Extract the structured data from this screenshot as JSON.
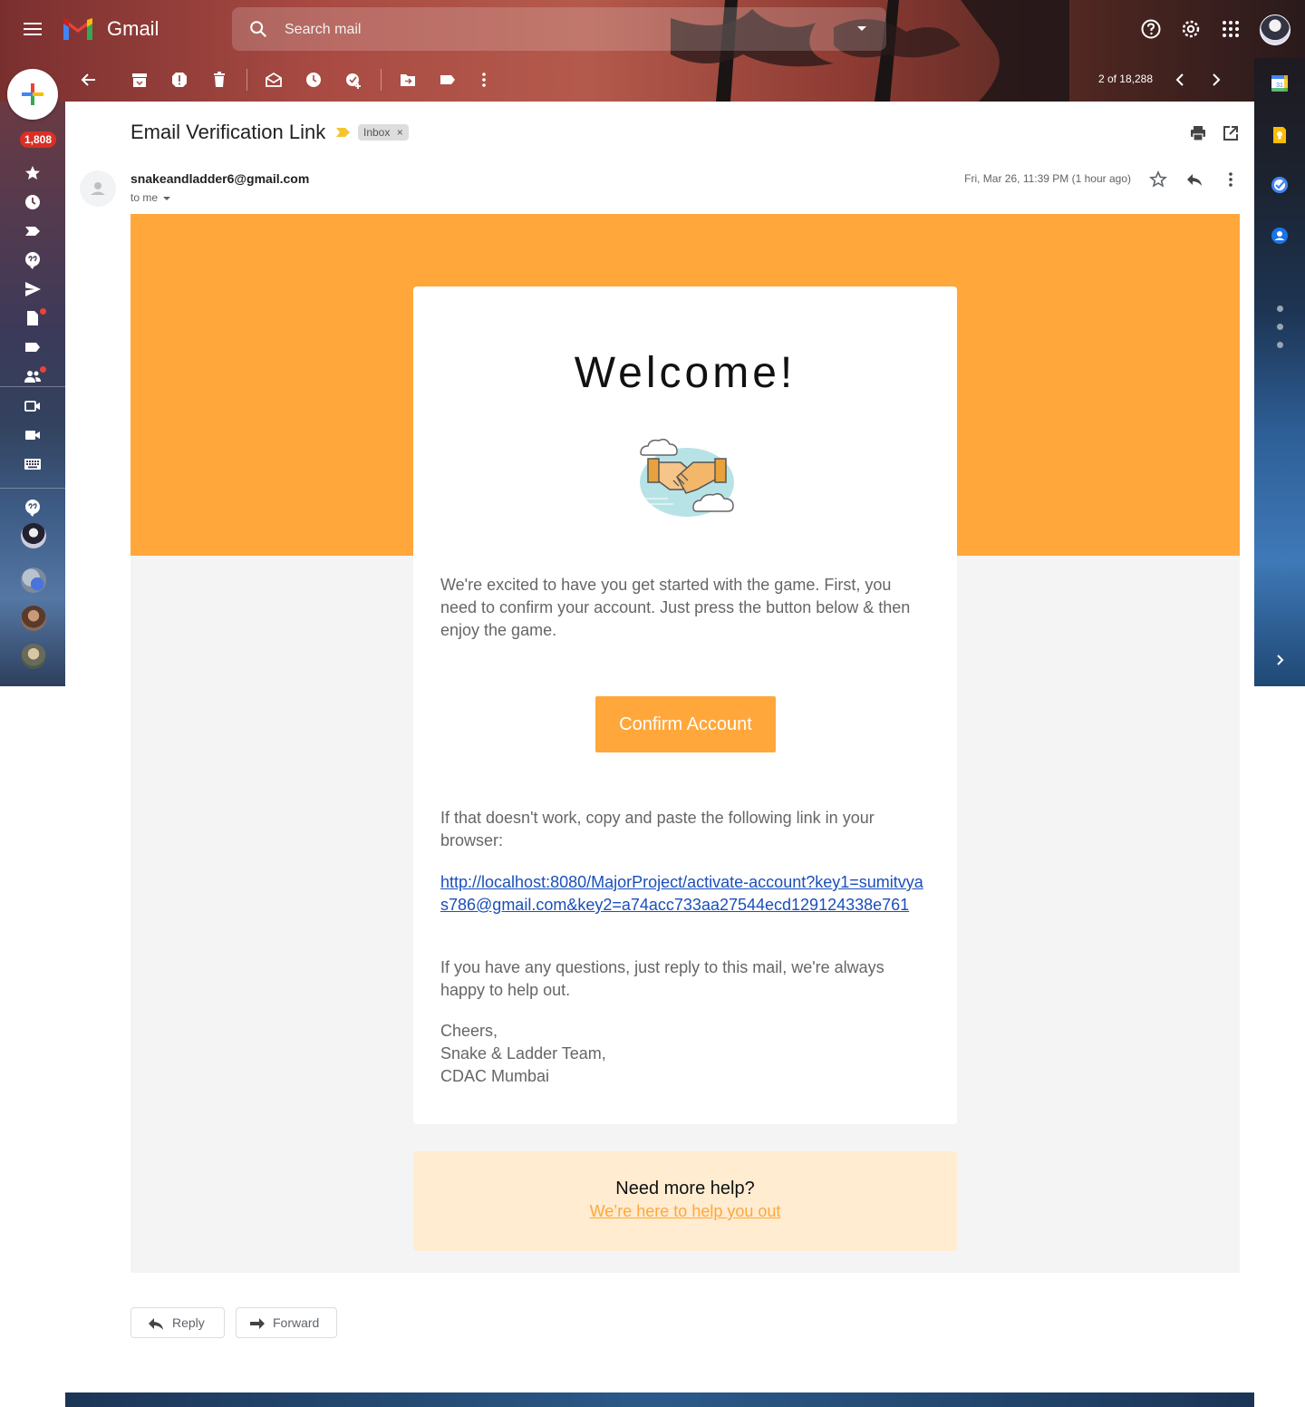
{
  "app": {
    "name": "Gmail"
  },
  "search": {
    "placeholder": "Search mail"
  },
  "toolbar": {
    "pager": "2 of 18,288"
  },
  "nav": {
    "inbox_badge": "1,808"
  },
  "message": {
    "subject": "Email Verification Link",
    "label_chip": "Inbox",
    "sender": "snakeandladder6@gmail.com",
    "recipient": "to me",
    "date": "Fri, Mar 26, 11:39 PM (1 hour ago)"
  },
  "email": {
    "heading": "Welcome!",
    "intro": "We're excited to have you get started with the game. First, you need to confirm your account. Just press the button below & then enjoy the game.",
    "button_label": "Confirm Account",
    "fallback_text": "If that doesn't work, copy and paste the following link in your browser:",
    "link": "http://localhost:8080/MajorProject/activate-account?key1=sumitvyas786@gmail.com&key2=a74acc733aa27544ecd129124338e761",
    "questions_text": "If you have any questions, just reply to this mail, we're always happy to help out.",
    "signoff": [
      "Cheers,",
      "Snake & Ladder Team,",
      "CDAC Mumbai"
    ],
    "help_title": "Need more help?",
    "help_link": "We’re here to help you out"
  },
  "actions": {
    "reply": "Reply",
    "forward": "Forward"
  },
  "colors": {
    "accent_orange": "#ffa73b",
    "help_bg": "#ffecd1",
    "link_blue": "#1a4fba",
    "badge_red": "#d93025"
  }
}
